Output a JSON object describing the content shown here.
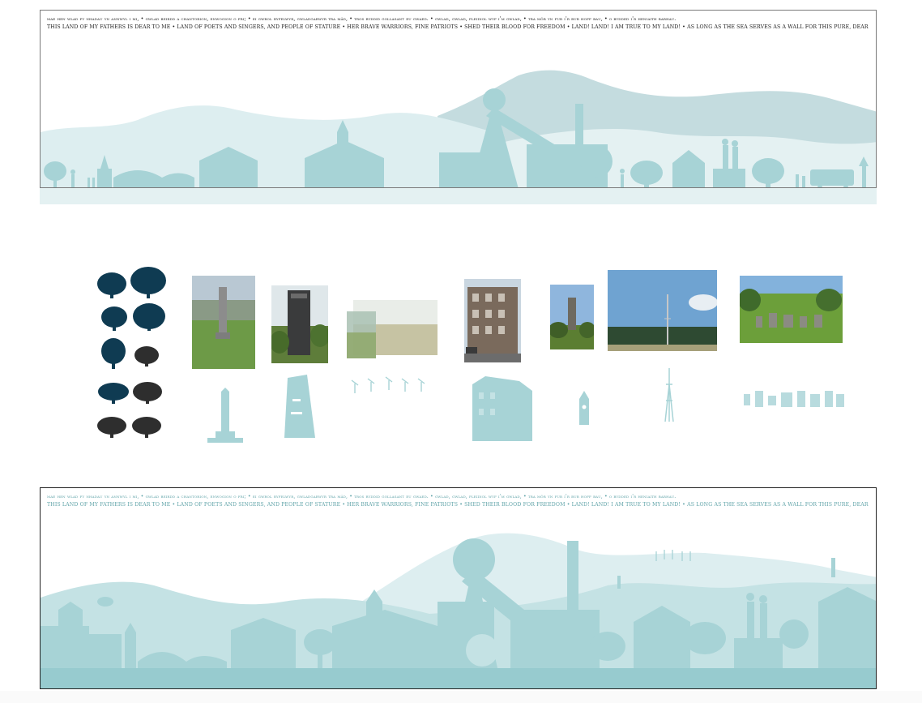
{
  "anthem": {
    "welsh": "Mae hen wlad fy nhadau yn annwyl i mi, • Gwlad beirdd a chantorion, enwogion o fri; • Ei gwrol ryfelwyr, gwladgarwyr tra mâd, • Tros ryddid gollasant eu gwaed. • Gwlad, gwlad, pleidiol wyf i'm gwlad, • Tra môr yn fur i'r bur hoff bau, • O bydded i'r heniaith barhau.",
    "english": "THIS LAND OF MY FATHERS IS DEAR TO ME • LAND OF POETS AND SINGERS, AND PEOPLE OF STATURE • HER BRAVE WARRIORS, FINE PATRIOTS • SHED THEIR BLOOD FOR FREEDOM • LAND! LAND! I AM TRUE TO MY LAND! • AS LONG AS THE SEA SERVES AS A WALL FOR THIS PURE, DEAR LAND • MAY THE LANGUAGE ENDURE FOR EVER."
  },
  "colors": {
    "silhouette": "#a7d3d6",
    "hill_dark": "#c4dcdf",
    "hill_light": "#ddeef0",
    "tree_dark": "#0f3b52",
    "tree_grey": "#2e2e2e",
    "frame": "#222222"
  },
  "references": [
    {
      "name": "tower-monument",
      "photo": "obelisk-monument-photo",
      "silhouette": "obelisk-silhouette"
    },
    {
      "name": "headframe-tower",
      "photo": "mine-tower-photo",
      "silhouette": "mine-tower-silhouette"
    },
    {
      "name": "wind-turbines",
      "photo": "hillside-photo",
      "silhouette": "wind-turbines-silhouette"
    },
    {
      "name": "terrace-building",
      "photo": "building-photo",
      "silhouette": "building-silhouette"
    },
    {
      "name": "clock-tower",
      "photo": "clock-tower-photo",
      "silhouette": "clock-tower-silhouette"
    },
    {
      "name": "transmitter-mast",
      "photo": "mast-photo",
      "silhouette": "mast-silhouette"
    },
    {
      "name": "stone-circle",
      "photo": "stone-circle-photo",
      "silhouette": "stone-circle-silhouette"
    }
  ]
}
